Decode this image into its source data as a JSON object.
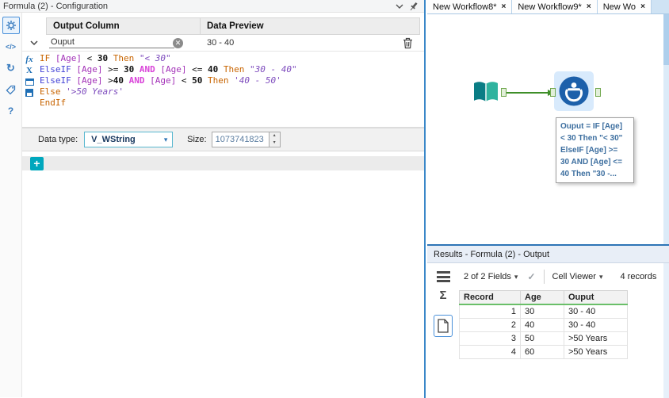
{
  "colors": {
    "accent_blue": "#2e75b6",
    "alteryx_teal": "#00a7bd",
    "selection_blue": "#4a90d9",
    "connection_green": "#3f8f29",
    "table_header_green": "#6abf69",
    "syntax": {
      "keyword": "#c86400",
      "elseif": "#4343d7",
      "field": "#a333b8",
      "and_operator": "#d943d9",
      "number": "#111111",
      "string": "#7d4bbd"
    }
  },
  "icons": {
    "caret": "▾",
    "spinner_up": "▴",
    "spinner_down": "▾",
    "check": "✓",
    "sigma": "Σ",
    "sync": "↻",
    "help": "?",
    "code": "</>",
    "fx": "fx",
    "x_constant": "X",
    "close": "×",
    "clear": "✕",
    "plus": "+"
  },
  "config_panel": {
    "title": "Formula (2) - Configuration",
    "col_output": "Output Column",
    "col_preview": "Data Preview",
    "expr_name": "Ouput",
    "expr_preview": "30 - 40",
    "formula_tokens": [
      [
        {
          "t": "IF",
          "c": "kw"
        },
        {
          "t": " ",
          "c": "op"
        },
        {
          "t": "[Age]",
          "c": "field"
        },
        {
          "t": " < ",
          "c": "op"
        },
        {
          "t": "30",
          "c": "num"
        },
        {
          "t": " ",
          "c": "op"
        },
        {
          "t": "Then",
          "c": "kw"
        },
        {
          "t": " ",
          "c": "op"
        },
        {
          "t": "\"< 30\"",
          "c": "str"
        }
      ],
      [
        {
          "t": "ElseIF",
          "c": "kw2"
        },
        {
          "t": " ",
          "c": "op"
        },
        {
          "t": "[Age]",
          "c": "field"
        },
        {
          "t": " >= ",
          "c": "op"
        },
        {
          "t": "30",
          "c": "num"
        },
        {
          "t": " ",
          "c": "op"
        },
        {
          "t": "AND",
          "c": "and"
        },
        {
          "t": " ",
          "c": "op"
        },
        {
          "t": "[Age]",
          "c": "field"
        },
        {
          "t": " <= ",
          "c": "op"
        },
        {
          "t": "40",
          "c": "num"
        },
        {
          "t": " ",
          "c": "op"
        },
        {
          "t": "Then",
          "c": "kw"
        },
        {
          "t": " ",
          "c": "op"
        },
        {
          "t": "\"30 - 40\"",
          "c": "str"
        }
      ],
      [
        {
          "t": "ElseIF",
          "c": "kw2"
        },
        {
          "t": " ",
          "c": "op"
        },
        {
          "t": "[Age]",
          "c": "field"
        },
        {
          "t": " >",
          "c": "op"
        },
        {
          "t": "40",
          "c": "num"
        },
        {
          "t": " ",
          "c": "op"
        },
        {
          "t": "AND",
          "c": "and"
        },
        {
          "t": " ",
          "c": "op"
        },
        {
          "t": "[Age]",
          "c": "field"
        },
        {
          "t": " < ",
          "c": "op"
        },
        {
          "t": "50",
          "c": "num"
        },
        {
          "t": " ",
          "c": "op"
        },
        {
          "t": "Then",
          "c": "kw"
        },
        {
          "t": " ",
          "c": "op"
        },
        {
          "t": "'40 - 50'",
          "c": "str"
        }
      ],
      [
        {
          "t": "Else",
          "c": "kw"
        },
        {
          "t": " ",
          "c": "op"
        },
        {
          "t": "'>50 Years'",
          "c": "str"
        }
      ],
      [
        {
          "t": "EndIf",
          "c": "kw"
        }
      ]
    ],
    "data_type_label": "Data type:",
    "data_type_value": "V_WString",
    "size_label": "Size:",
    "size_value": "1073741823"
  },
  "canvas": {
    "tabs": [
      "New Workflow8*",
      "New Workflow9*",
      "New Wo"
    ],
    "tools": [
      "text-input-tool",
      "formula-tool"
    ],
    "annotation_lines": [
      "Ouput = IF [Age]",
      "< 30 Then \"< 30\"",
      "ElseIF [Age] >=",
      "30 AND [Age] <=",
      "40 Then \"30 -..."
    ]
  },
  "results": {
    "title": "Results - Formula (2) - Output",
    "fields_selector": "2 of 2 Fields",
    "cell_viewer": "Cell Viewer",
    "record_count": "4 records",
    "headers": [
      "Record",
      "Age",
      "Ouput"
    ],
    "rows": [
      [
        "1",
        "30",
        "30 - 40"
      ],
      [
        "2",
        "40",
        "30 - 40"
      ],
      [
        "3",
        "50",
        ">50 Years"
      ],
      [
        "4",
        "60",
        ">50 Years"
      ]
    ]
  }
}
